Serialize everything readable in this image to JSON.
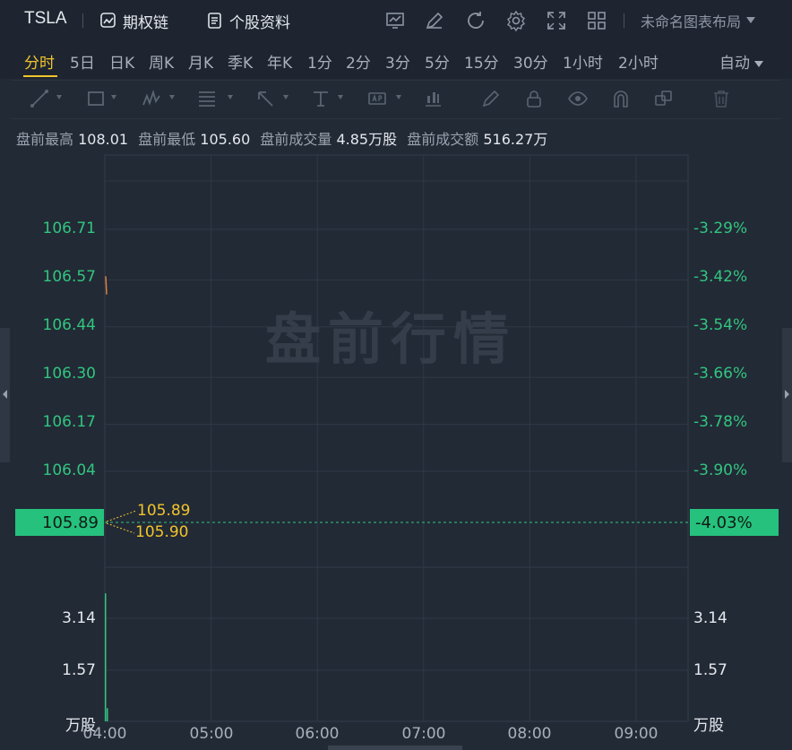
{
  "header": {
    "symbol": "TSLA",
    "options_chain_label": "期权链",
    "profile_label": "个股资料",
    "layout_label": "未命名图表布局"
  },
  "periods": {
    "items": [
      "分时",
      "5日",
      "日K",
      "周K",
      "月K",
      "季K",
      "年K",
      "1分",
      "2分",
      "3分",
      "5分",
      "15分",
      "30分",
      "1小时",
      "2小时"
    ],
    "active": "分时",
    "auto_label": "自动"
  },
  "stats": {
    "high_label": "盘前最高",
    "high_value": "108.01",
    "low_label": "盘前最低",
    "low_value": "105.60",
    "volume_label": "盘前成交量",
    "volume_value": "4.85万股",
    "turnover_label": "盘前成交额",
    "turnover_value": "516.27万"
  },
  "chart_data": {
    "type": "line",
    "watermark": "盘前行情",
    "price_axis": [
      "106.71",
      "106.57",
      "106.44",
      "106.30",
      "106.17",
      "106.04"
    ],
    "percent_axis": [
      "-3.29%",
      "-3.42%",
      "-3.54%",
      "-3.66%",
      "-3.78%",
      "-3.90%"
    ],
    "current_price": "105.89",
    "current_percent": "-4.03%",
    "annotations": [
      "105.89",
      "105.90"
    ],
    "volume_axis": [
      "3.14",
      "1.57"
    ],
    "volume_unit": "万股",
    "x_ticks": [
      "04:00",
      "05:00",
      "06:00",
      "07:00",
      "08:00",
      "09:00"
    ],
    "ylim": [
      105.89,
      106.71
    ],
    "price_series": [
      {
        "x": "04:00",
        "y": 106.58
      },
      {
        "x": "04:00",
        "y": 106.53
      }
    ],
    "volume_series": [
      {
        "x": "04:00",
        "v": 3.9
      },
      {
        "x": "04:00",
        "v": 0.4
      }
    ],
    "colors": {
      "up": "#32c57f",
      "price_line": "#e0813a",
      "annotation": "#f2c42b"
    }
  }
}
